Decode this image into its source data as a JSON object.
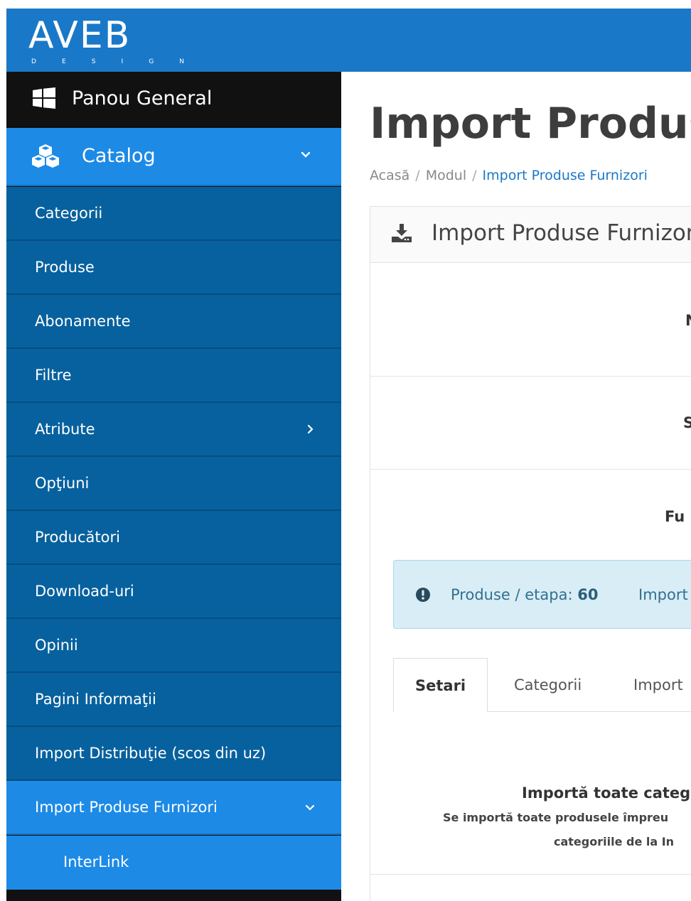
{
  "brand": {
    "logo_main": "AVEB",
    "logo_sub": [
      "D",
      "E",
      "S",
      "I",
      "G",
      "N"
    ]
  },
  "sidebar": {
    "dashboard": {
      "label": "Panou General",
      "icon": "windows-icon"
    },
    "catalog": {
      "label": "Catalog",
      "icon": "cubes-icon"
    },
    "items": [
      {
        "label": "Categorii"
      },
      {
        "label": "Produse"
      },
      {
        "label": "Abonamente"
      },
      {
        "label": "Filtre"
      },
      {
        "label": "Atribute"
      },
      {
        "label": "Opţiuni"
      },
      {
        "label": "Producători"
      },
      {
        "label": "Download-uri"
      },
      {
        "label": "Opinii"
      },
      {
        "label": "Pagini Informaţii"
      },
      {
        "label": "Import Distribuţie (scos din uz)"
      },
      {
        "label": "Import Produse Furnizori"
      }
    ],
    "sub_items": [
      {
        "label": "InterLink"
      }
    ]
  },
  "page": {
    "title": "Import Produse",
    "breadcrumb": [
      "Acasă",
      "Modul",
      "Import Produse Furnizori"
    ],
    "panel_title": "Import Produse Furnizori",
    "rows": [
      {
        "label": "N"
      },
      {
        "label": "S"
      },
      {
        "label": "Fu"
      }
    ],
    "alert": {
      "prefix": "Produse / etapa: ",
      "value": "60",
      "suffix": "Import"
    },
    "tabs": [
      "Setari",
      "Categorii",
      "Import"
    ],
    "settings": {
      "heading": "Importă toate categ",
      "line1": "Se importă toate produsele împreu",
      "line2": "categoriile de la In"
    }
  },
  "colors": {
    "topbar": "#1978c8",
    "sidebar_active": "#1d8ae6",
    "sidebar_item": "#07619e",
    "sidebar_dark": "#111111",
    "alert_bg": "#d9edf7"
  }
}
